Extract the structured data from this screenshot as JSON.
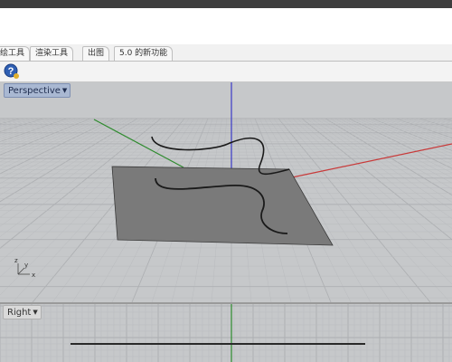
{
  "tabs": [
    {
      "label": "绘工具"
    },
    {
      "label": "渲染工具"
    },
    {
      "label": "出图"
    },
    {
      "label": "5.0 的新功能"
    }
  ],
  "toolbar": {
    "help_icon": "help-question-icon"
  },
  "viewports": {
    "perspective": {
      "label": "Perspective",
      "dropdown_icon": "chevron-down-icon",
      "state": "active"
    },
    "right": {
      "label": "Right",
      "dropdown_icon": "chevron-down-icon",
      "state": "inactive"
    }
  },
  "axis_indicator": {
    "x": "x",
    "y": "y",
    "z": "z"
  },
  "colors": {
    "x_axis": "#c83a3a",
    "y_axis": "#2e8b2e",
    "z_axis": "#3a3ac8",
    "grid_background": "#c6c8ca",
    "plane_fill": "#7a7a7a",
    "curve": "#1a1a1a",
    "active_label": "#a9b8d2"
  }
}
